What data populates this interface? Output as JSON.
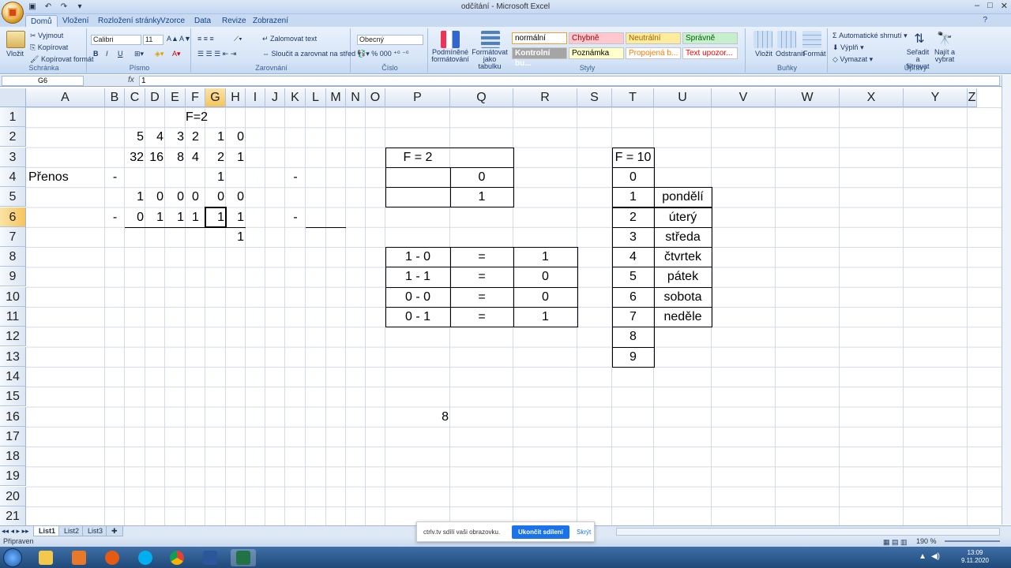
{
  "window": {
    "title": "odčítání - Microsoft Excel"
  },
  "tabs": [
    "Domů",
    "Vložení",
    "Rozložení stránky",
    "Vzorce",
    "Data",
    "Revize",
    "Zobrazení"
  ],
  "ribbon": {
    "clipboard": {
      "paste": "Vložit",
      "cut": "Vyjmout",
      "copy": "Kopírovat",
      "format_painter": "Kopírovat formát",
      "label": "Schránka"
    },
    "font": {
      "name": "Calibri",
      "size": "11",
      "bold": "B",
      "italic": "I",
      "underline": "U",
      "label": "Písmo"
    },
    "alignment": {
      "wrap": "Zalomovat text",
      "merge": "Sloučit a zarovnat na střed",
      "label": "Zarovnání"
    },
    "number": {
      "format": "Obecný",
      "label": "Číslo"
    },
    "styles": {
      "conditional": "Podmíněné formátování",
      "as_table": "Formátovat jako tabulku",
      "items": [
        {
          "label": "normální",
          "bg": "#ffffff",
          "color": "#000000"
        },
        {
          "label": "Chybně",
          "bg": "#ffc7ce",
          "color": "#9c0006"
        },
        {
          "label": "Neutrální",
          "bg": "#ffeb9c",
          "color": "#9c6500"
        },
        {
          "label": "Správně",
          "bg": "#c6efce",
          "color": "#006100"
        },
        {
          "label": "Kontrolní bu...",
          "bg": "#a5a5a5",
          "color": "#ffffff"
        },
        {
          "label": "Poznámka",
          "bg": "#ffffcc",
          "color": "#000000"
        },
        {
          "label": "Propojená b...",
          "bg": "#ffffff",
          "color": "#fa7d00"
        },
        {
          "label": "Text upozor...",
          "bg": "#ffffff",
          "color": "#ff0000"
        }
      ],
      "label": "Styly"
    },
    "cells": {
      "insert": "Vložit",
      "delete": "Odstranit",
      "format": "Formát",
      "label": "Buňky"
    },
    "editing": {
      "autosum": "Automatické shrnutí",
      "fill": "Výplň",
      "clear": "Vymazat",
      "sort": "Seřadit a filtrovat",
      "find": "Najít a vybrat",
      "label": "Úpravy"
    }
  },
  "formula_bar": {
    "name_box": "G6",
    "fx": "fx",
    "value": "1"
  },
  "columns": [
    "A",
    "B",
    "C",
    "D",
    "E",
    "F",
    "G",
    "H",
    "I",
    "J",
    "K",
    "L",
    "M",
    "N",
    "O",
    "P",
    "Q",
    "R",
    "S",
    "T",
    "U",
    "V",
    "W",
    "X",
    "Y",
    "Z"
  ],
  "rows": [
    "1",
    "2",
    "3",
    "4",
    "5",
    "6",
    "7",
    "8",
    "9",
    "10",
    "11",
    "12",
    "13",
    "14",
    "15",
    "16",
    "17",
    "18",
    "19",
    "20",
    "21"
  ],
  "cells": {
    "F1": "F=2",
    "C2": "5",
    "D2": "4",
    "E2": "3",
    "F2": "2",
    "G2": "1",
    "H2": "0",
    "C3": "32",
    "D3": "16",
    "E3": "8",
    "F3": "4",
    "G3": "2",
    "H3": "1",
    "A4": "Přenos",
    "B4": "-",
    "G4": "1",
    "K4": "-",
    "C5": "1",
    "D5": "0",
    "E5": "0",
    "F5": "0",
    "G5": "0",
    "H5": "0",
    "B6": "-",
    "C6": "0",
    "D6": "1",
    "E6": "1",
    "F6": "1",
    "G6": "1",
    "H6": "1",
    "K6": "-",
    "H7": "1",
    "P3": "F = 2",
    "Q4": "0",
    "Q5": "1",
    "P8": "1 - 0",
    "Q8": "=",
    "R8": "1",
    "P9": "1 - 1",
    "Q9": "=",
    "R9": "0",
    "P10": "0 - 0",
    "Q10": "=",
    "R10": "0",
    "P11": "0 - 1",
    "Q11": "=",
    "R11": "1",
    "P16": "8",
    "T3": "F = 10",
    "T4": "0",
    "T5": "1",
    "T6": "2",
    "T7": "3",
    "T8": "4",
    "T9": "5",
    "T10": "6",
    "T11": "7",
    "T12": "8",
    "T13": "9",
    "U5": "pondělí",
    "U6": "úterý",
    "U7": "středa",
    "U8": "čtvrtek",
    "U9": "pátek",
    "U10": "sobota",
    "U11": "neděle"
  },
  "sheets": [
    "List1",
    "List2",
    "List3"
  ],
  "status": {
    "ready": "Připraven",
    "zoom": "190 %"
  },
  "share_bar": {
    "message": "ctrlv.tv sdílí vaši obrazovku.",
    "stop": "Ukončit sdílení",
    "hide": "Skrýt"
  },
  "taskbar": {
    "time": "13:09",
    "date": "9.11.2020"
  }
}
